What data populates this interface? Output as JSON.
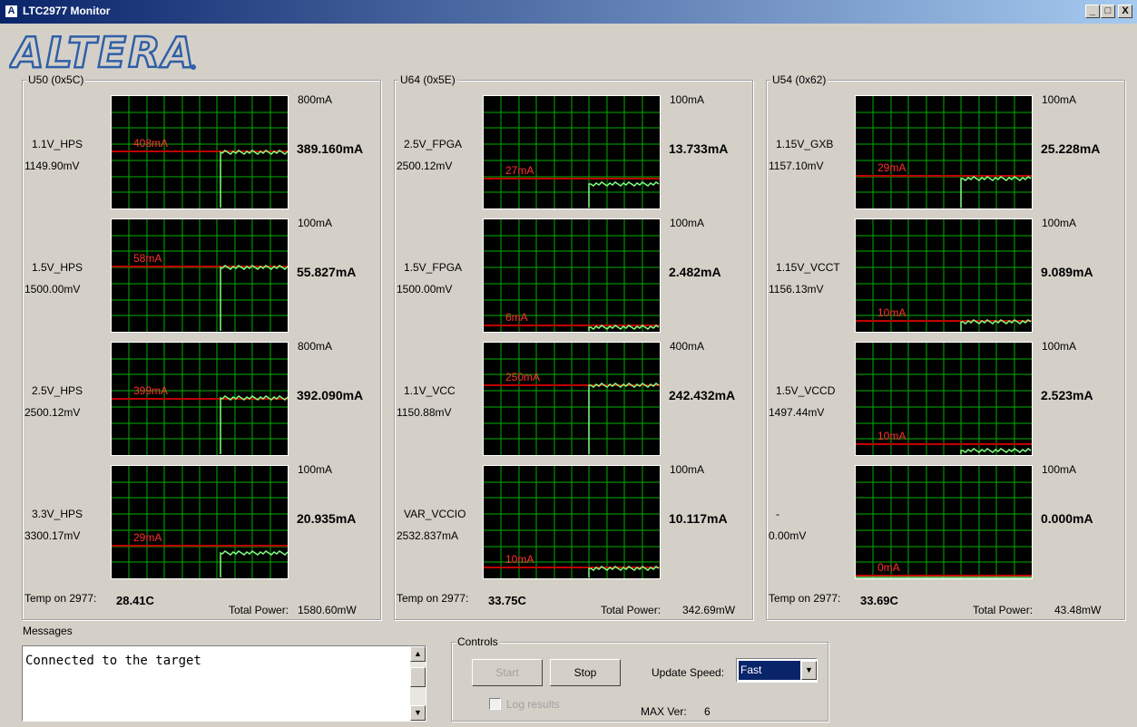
{
  "window": {
    "title": "LTC2977 Monitor",
    "minimize": "_",
    "maximize": "□",
    "close": "X"
  },
  "logo": {
    "text": "ALTERA"
  },
  "colors": {
    "graph_bg": "#000000",
    "grid": "#00b000",
    "trace": "#80ff80",
    "limit_line": "#c00000",
    "limit_text": "#ff3030",
    "titlebar": "#0a246a"
  },
  "groups": [
    {
      "label": "U50 (0x5C)",
      "temp_label": "Temp on 2977:",
      "temp": "28.41C",
      "power_label": "Total Power:",
      "power": "1580.60mW",
      "rails": [
        {
          "name": "1.1V_HPS",
          "voltage": "1149.90mV",
          "max": "800mA",
          "current": "389.160mA",
          "limit": "408mA",
          "limit_frac": 0.51,
          "step_frac": 0.62,
          "level_frac": 0.486
        },
        {
          "name": "1.5V_HPS",
          "voltage": "1500.00mV",
          "max": "100mA",
          "current": "55.827mA",
          "limit": "58mA",
          "limit_frac": 0.58,
          "step_frac": 0.62,
          "level_frac": 0.558
        },
        {
          "name": "2.5V_HPS",
          "voltage": "2500.12mV",
          "max": "800mA",
          "current": "392.090mA",
          "limit": "399mA",
          "limit_frac": 0.499,
          "step_frac": 0.62,
          "level_frac": 0.49
        },
        {
          "name": "3.3V_HPS",
          "voltage": "3300.17mV",
          "max": "100mA",
          "current": "20.935mA",
          "limit": "29mA",
          "limit_frac": 0.29,
          "step_frac": 0.62,
          "level_frac": 0.209
        }
      ]
    },
    {
      "label": "U64 (0x5E)",
      "temp_label": "Temp on 2977:",
      "temp": "33.75C",
      "power_label": "Total Power:",
      "power": "342.69mW",
      "rails": [
        {
          "name": "2.5V_FPGA",
          "voltage": "2500.12mV",
          "max": "100mA",
          "current": "13.733mA",
          "limit": "27mA",
          "limit_frac": 0.27,
          "step_frac": 0.6,
          "level_frac": 0.2
        },
        {
          "name": "1.5V_FPGA",
          "voltage": "1500.00mV",
          "max": "100mA",
          "current": "2.482mA",
          "limit": "6mA",
          "limit_frac": 0.06,
          "step_frac": 0.6,
          "level_frac": 0.025
        },
        {
          "name": "1.1V_VCC",
          "voltage": "1150.88mV",
          "max": "400mA",
          "current": "242.432mA",
          "limit": "250mA",
          "limit_frac": 0.625,
          "step_frac": 0.6,
          "level_frac": 0.606
        },
        {
          "name": "VAR_VCCIO",
          "voltage": "2532.837mA",
          "max": "100mA",
          "current": "10.117mA",
          "limit": "10mA",
          "limit_frac": 0.1,
          "step_frac": 0.6,
          "level_frac": 0.07
        }
      ]
    },
    {
      "label": "U54 (0x62)",
      "temp_label": "Temp on 2977:",
      "temp": "33.69C",
      "power_label": "Total Power:",
      "power": "43.48mW",
      "rails": [
        {
          "name": "1.15V_GXB",
          "voltage": "1157.10mV",
          "max": "100mA",
          "current": "25.228mA",
          "limit": "29mA",
          "limit_frac": 0.29,
          "step_frac": 0.6,
          "level_frac": 0.252
        },
        {
          "name": "1.15V_VCCT",
          "voltage": "1156.13mV",
          "max": "100mA",
          "current": "9.089mA",
          "limit": "10mA",
          "limit_frac": 0.1,
          "step_frac": 0.6,
          "level_frac": 0.07
        },
        {
          "name": "1.5V_VCCD",
          "voltage": "1497.44mV",
          "max": "100mA",
          "current": "2.523mA",
          "limit": "10mA",
          "limit_frac": 0.1,
          "step_frac": 0.6,
          "level_frac": 0.025
        },
        {
          "name": "-",
          "voltage": "0.00mV",
          "max": "100mA",
          "current": "0.000mA",
          "limit": "0mA",
          "limit_frac": 0.0,
          "step_frac": 1.0,
          "level_frac": 0.0
        }
      ]
    }
  ],
  "messages": {
    "label": "Messages",
    "text": "Connected to the target",
    "scroll_up": "▲",
    "scroll_down": "▼"
  },
  "controls": {
    "label": "Controls",
    "start": "Start",
    "stop": "Stop",
    "update_speed_label": "Update Speed:",
    "update_speed": "Fast",
    "log_results": "Log results",
    "max_ver_label": "MAX Ver:",
    "max_ver": "6",
    "dropdown_arrow": "▼"
  }
}
